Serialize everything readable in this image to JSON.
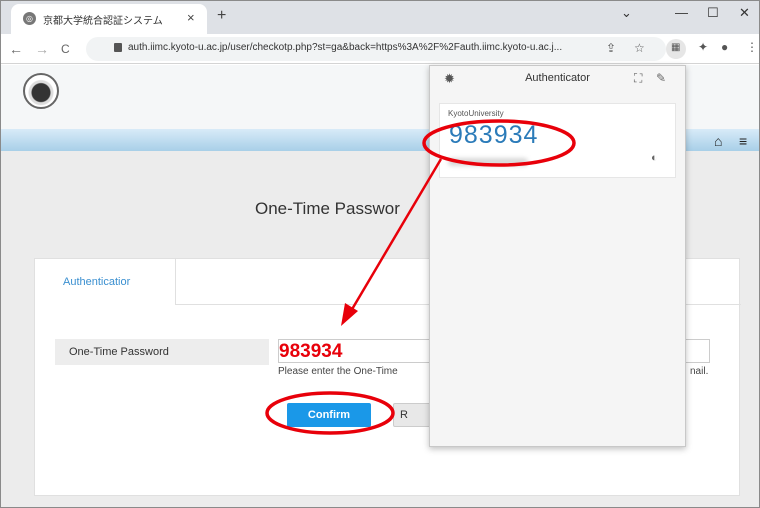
{
  "browser": {
    "tab_title": "京都大学統合認証システム",
    "tab_close": "×",
    "new_tab": "+",
    "window_controls": [
      "⌄",
      "—",
      "☐",
      "✕"
    ],
    "nav": {
      "back": "←",
      "forward": "→",
      "reload": "C"
    },
    "url": "auth.iimc.kyoto-u.ac.jp/user/checkotp.php?st=ga&back=https%3A%2F%2Fauth.iimc.kyoto-u.ac.j...",
    "toolbar_icons": [
      "share-icon",
      "star-icon",
      "authenticator-extension-icon",
      "puzzle-icon",
      "profile-icon",
      "menu-icon"
    ]
  },
  "page": {
    "title": "One-Time Passwor",
    "tab_label": "Authenticatior",
    "field_label": "One-Time Password",
    "input_value": "",
    "hint_left": "Please enter the One-Time",
    "hint_right": "nail.",
    "confirm_label": "Confirm",
    "reset_label": "R"
  },
  "popup": {
    "title": "Authenticator",
    "issuer": "KyotoUniversity",
    "code": "983934"
  },
  "annotation": {
    "typed_code": "983934",
    "color": "#e8000a"
  }
}
